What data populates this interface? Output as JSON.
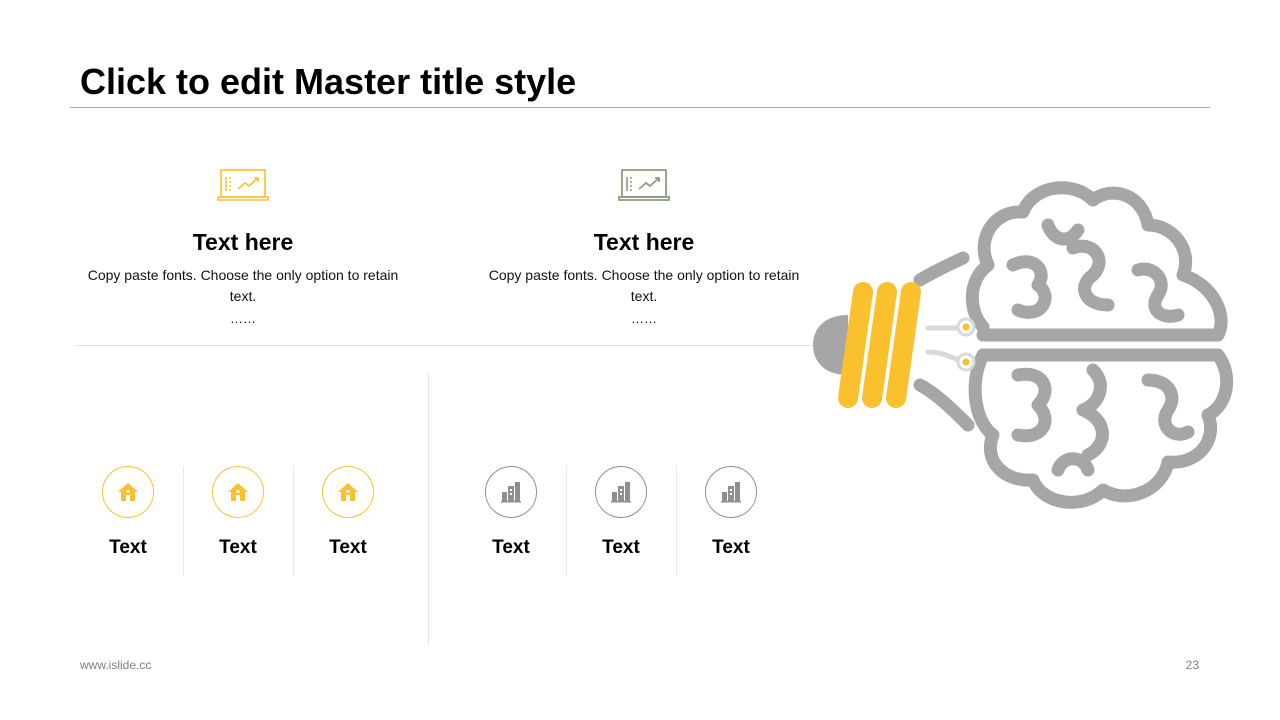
{
  "title": "Click to edit Master title style",
  "colors": {
    "accent": "#fbc02d",
    "gray": "#a6a6a6",
    "icon_green_gray": "#8c9c7f"
  },
  "features": [
    {
      "icon": "laptop-chart-icon",
      "heading": "Text here",
      "body": "Copy paste fonts. Choose the only option to retain text.",
      "ellipsis": "……"
    },
    {
      "icon": "laptop-chart-icon",
      "heading": "Text here",
      "body": "Copy paste fonts. Choose the only option to retain text.",
      "ellipsis": "……"
    }
  ],
  "groups": [
    {
      "icon": "home-icon",
      "items": [
        {
          "label": "Text"
        },
        {
          "label": "Text"
        },
        {
          "label": "Text"
        }
      ]
    },
    {
      "icon": "building-icon",
      "items": [
        {
          "label": "Text"
        },
        {
          "label": "Text"
        },
        {
          "label": "Text"
        }
      ]
    }
  ],
  "illustration": "brain-bulb-icon",
  "footer": {
    "site": "www.islide.cc",
    "page": "23"
  }
}
